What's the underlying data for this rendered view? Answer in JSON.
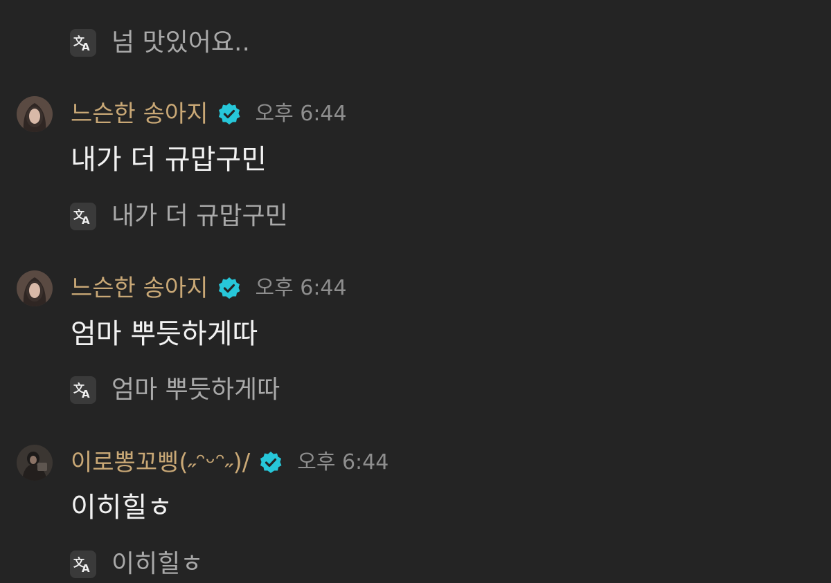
{
  "colors": {
    "background": "#242424",
    "username": "#c9a876",
    "timestamp": "#8e8e8e",
    "message": "#f2f2f2",
    "translation": "#a9a9a9",
    "verified_badge": "#27c7d9"
  },
  "icons": {
    "translate": "translate-icon",
    "verified": "verified-badge-icon"
  },
  "top_translation": {
    "text": "넘 맛있어요.."
  },
  "messages": [
    {
      "username": "느슨한 송아지",
      "verified": true,
      "time": "오후 6:44",
      "text": "내가 더 규맙구민",
      "translation": "내가 더 규맙구민"
    },
    {
      "username": "느슨한 송아지",
      "verified": true,
      "time": "오후 6:44",
      "text": "엄마 뿌듯하게따",
      "translation": "엄마 뿌듯하게따"
    },
    {
      "username": "이로뽕꼬삥(˶ᵔᵕᵔ˶)/",
      "verified": true,
      "time": "오후 6:44",
      "text": "이히힐ㅎ",
      "translation": "이히힐ㅎ"
    }
  ]
}
